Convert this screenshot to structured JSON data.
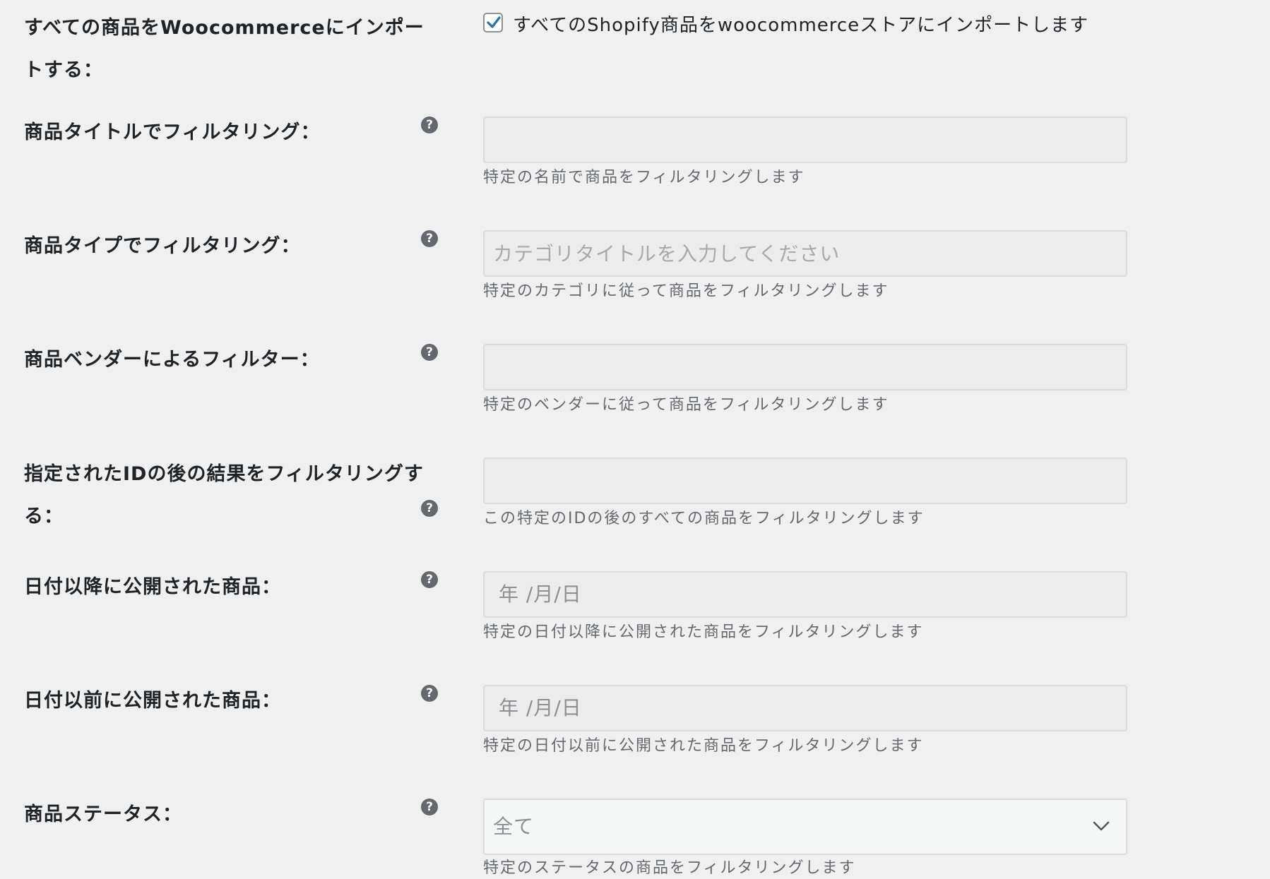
{
  "import_all": {
    "label": "すべての商品をWoocommerceにインポートする：",
    "checkbox_label": "すべてのShopify商品をwoocommerceストアにインポートします",
    "checked": true
  },
  "filter_title": {
    "label": "商品タイトルでフィルタリング：",
    "value": "",
    "placeholder": "",
    "description": "特定の名前で商品をフィルタリングします"
  },
  "filter_type": {
    "label": "商品タイプでフィルタリング：",
    "value": "",
    "placeholder": "カテゴリタイトルを入力してください",
    "description": "特定のカテゴリに従って商品をフィルタリングします"
  },
  "filter_vendor": {
    "label": "商品ベンダーによるフィルター：",
    "value": "",
    "placeholder": "",
    "description": "特定のベンダーに従って商品をフィルタリングします"
  },
  "filter_since_id": {
    "label": "指定されたIDの後の結果をフィルタリングする：",
    "value": "",
    "placeholder": "",
    "description": "この特定のIDの後のすべての商品をフィルタリングします"
  },
  "published_after": {
    "label": "日付以降に公開された商品：",
    "placeholder": "年 /月/日",
    "description": "特定の日付以降に公開された商品をフィルタリングします"
  },
  "published_before": {
    "label": "日付以前に公開された商品：",
    "placeholder": "年 /月/日",
    "description": "特定の日付以前に公開された商品をフィルタリングします"
  },
  "product_status": {
    "label": "商品ステータス：",
    "selected": "全て",
    "description": "特定のステータスの商品をフィルタリングします"
  },
  "help_glyph": "?",
  "icons": {
    "help": "question-circle-icon",
    "check": "checkmark-icon",
    "dropdown": "chevron-down-icon"
  },
  "colors": {
    "background": "#f0f0f1",
    "checkmark": "#2271b1",
    "help_icon": "#646970",
    "field_bg": "#ececec",
    "field_border": "#dcdcde"
  }
}
